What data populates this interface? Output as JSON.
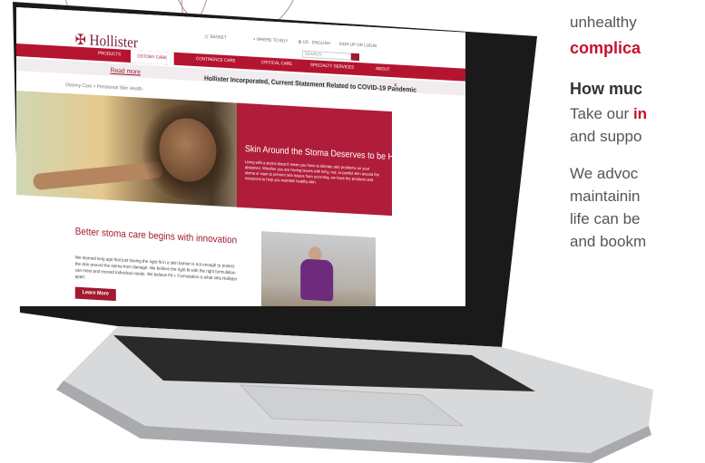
{
  "article": {
    "line1_text": "unhealthy",
    "line2_text": "complica",
    "line3_text": "How muc",
    "line4_prefix": "Take our ",
    "line4_highlight": "in",
    "line5_text": "and suppo",
    "line6_text": "We advoc",
    "line7_text": "maintainin",
    "line8_text": "life can be",
    "line9_text": "and bookm"
  },
  "site": {
    "brand": "Hollister",
    "utility": {
      "basket": "BASKET",
      "where_to_buy": "WHERE TO BUY",
      "region": "US · ENGLISH",
      "sign_up": "SIGN UP OR LOGIN",
      "search_placeholder": "SEARCH"
    },
    "nav": [
      "PRODUCTS",
      "OSTOMY CARE",
      "CONTINENCE CARE",
      "CRITICAL CARE",
      "SPECIALTY SERVICES",
      "ABOUT"
    ],
    "banner": {
      "text": "Hollister Incorporated, Current Statement Related to COVID-19 Pandemic",
      "link": "Read more",
      "close": "×"
    },
    "breadcrumb": "Ostomy Care  >  Peristomal Skin Health",
    "hero": {
      "heading": "Skin Around the Stoma Deserves to be Healthy",
      "body": "Living with a stoma doesn't mean you have to tolerate skin problems on your abdomen. Whether you are having issues with itchy, red, or painful skin around the stoma or want to prevent skin issues from occurring, we have the products and resources to help you maintain healthy skin."
    },
    "promo": {
      "title": "Better stoma care begins with innovation",
      "text": "We learned long ago that just having the right fit in a skin barrier is not enough to protect the skin around the stoma from damage. We believe the right fit with the right formulation can meet and exceed individual needs. We believe Fit + Formulation is what sets Hollister apart.",
      "button": "Learn More"
    }
  },
  "colors": {
    "brand_red": "#b01d3a",
    "text_gray": "#555555"
  }
}
